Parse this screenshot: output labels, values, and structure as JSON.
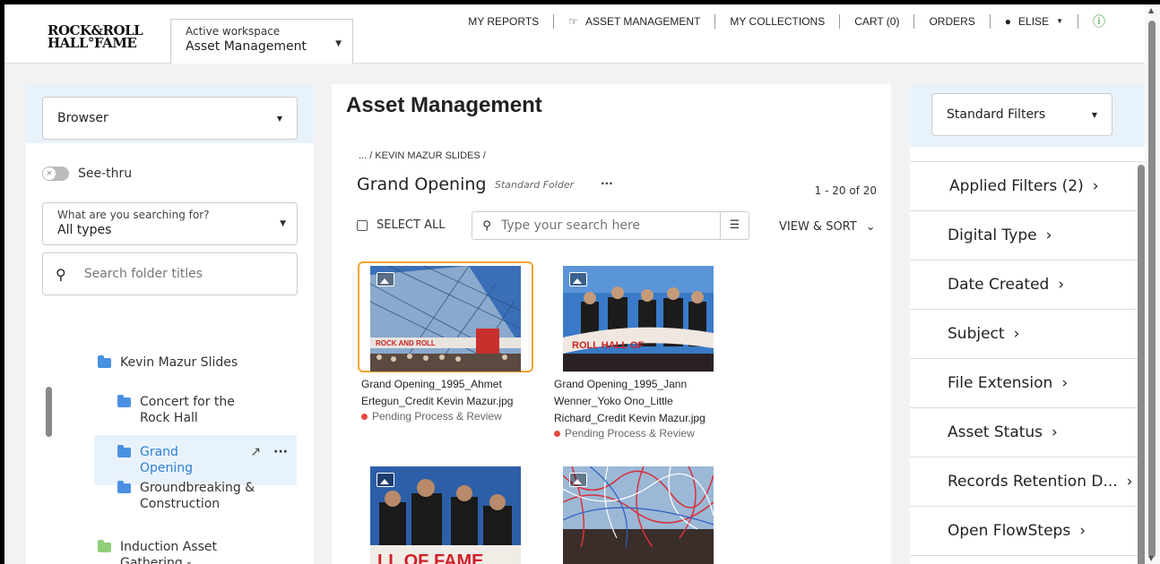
{
  "header": {
    "logo_line1": "ROCK&ROLL",
    "logo_line2": "HALL°FAME",
    "workspace_label": "Active workspace",
    "workspace_value": "Asset Management",
    "nav": [
      "MY REPORTS",
      "ASSET MANAGEMENT",
      "MY COLLECTIONS",
      "CART (0)",
      "ORDERS",
      "ELISE"
    ]
  },
  "left": {
    "browser_select": "Browser",
    "see_thru": "See-thru",
    "type_label": "What are you searching for?",
    "type_value": "All types",
    "folder_search_placeholder": "Search folder titles",
    "tree": [
      "Kevin Mazur Slides",
      "Concert for the Rock Hall",
      "Grand Opening",
      "Groundbreaking & Construction",
      "Induction Asset Gathering - Marketing"
    ]
  },
  "center": {
    "title": "Asset Management",
    "breadcrumb": "... / KEVIN MAZUR SLIDES /",
    "folder_title": "Grand Opening",
    "folder_type": "Standard Folder",
    "count": "1 - 20 of 20",
    "select_all": "SELECT ALL",
    "search_placeholder": "Type your search here",
    "view_sort": "VIEW & SORT",
    "assets": [
      {
        "name": "Grand Opening_1995_Ahmet Ertegun_Credit Kevin Mazur.jpg",
        "status": "Pending Process & Review"
      },
      {
        "name": "Grand Opening_1995_Jann Wenner_Yoko Ono_Little Richard_Credit Kevin Mazur.jpg",
        "status": "Pending Process & Review"
      },
      {
        "name": "",
        "status": ""
      },
      {
        "name": "",
        "status": ""
      }
    ]
  },
  "right": {
    "select": "Standard Filters",
    "filters": [
      "Applied Filters (2)",
      "Digital Type",
      "Date Created",
      "Subject",
      "File Extension",
      "Asset Status",
      "Records Retention D...",
      "Open FlowSteps"
    ]
  },
  "colors": {
    "accent": "#2f7fd6",
    "selected_border": "#f0a530",
    "status_dot": "#e8483c"
  }
}
